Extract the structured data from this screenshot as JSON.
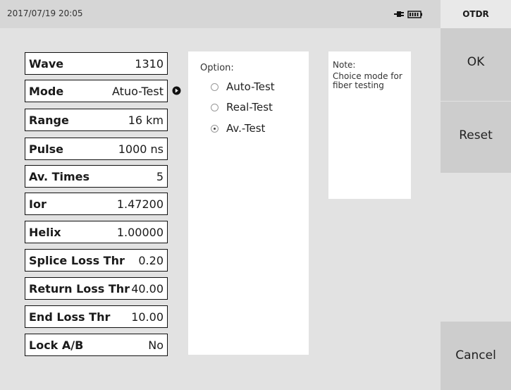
{
  "status": {
    "datetime": "2017/07/19 20:05",
    "power_icon": "plug-icon",
    "battery_icon": "battery-icon"
  },
  "app_title": "OTDR",
  "side_buttons": {
    "ok": "OK",
    "reset": "Reset",
    "cancel": "Cancel"
  },
  "params": [
    {
      "label": "Wave",
      "value": "1310"
    },
    {
      "label": "Mode",
      "value": "Atuo-Test"
    },
    {
      "label": "Range",
      "value": "16 km"
    },
    {
      "label": "Pulse",
      "value": "1000 ns"
    },
    {
      "label": "Av. Times",
      "value": "5"
    },
    {
      "label": "Ior",
      "value": "1.47200"
    },
    {
      "label": "Helix",
      "value": "1.00000"
    },
    {
      "label": "Splice Loss Thr",
      "value": "0.20"
    },
    {
      "label": "Return Loss Thr",
      "value": "40.00"
    },
    {
      "label": "End Loss Thr",
      "value": "10.00"
    },
    {
      "label": "Lock A/B",
      "value": "No"
    }
  ],
  "option": {
    "title": "Option:",
    "items": [
      {
        "label": "Auto-Test",
        "selected": false
      },
      {
        "label": "Real-Test",
        "selected": false
      },
      {
        "label": "Av.-Test",
        "selected": true
      }
    ]
  },
  "note": {
    "title": "Note:",
    "text": "Choice mode for fiber testing"
  },
  "colors": {
    "background": "#e2e2e2",
    "panel": "#ffffff",
    "side_button": "#cdcdcd"
  }
}
